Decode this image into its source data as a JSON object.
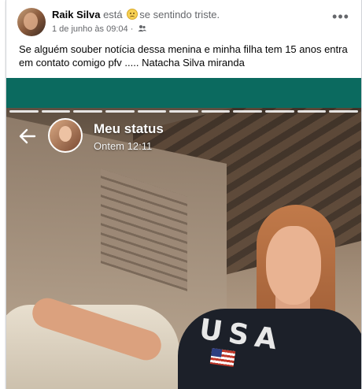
{
  "post": {
    "author": "Raik Silva",
    "feeling_prefix": "está",
    "feeling_text": "se sentindo triste.",
    "date": "1 de junho às 09:04",
    "more_icon": "ellipsis-icon",
    "audience_icon": "friends-icon",
    "text": "Se alguém souber notícia dessa menina e minha filha  tem 15 anos entra em contato comigo pfv ..... Natacha Silva miranda"
  },
  "status": {
    "title": "Meu status",
    "time": "Ontem 12:11",
    "back_icon": "arrow-left-icon",
    "band_color": "#0b6a5f"
  },
  "photo": {
    "shirt_text": "USA"
  }
}
